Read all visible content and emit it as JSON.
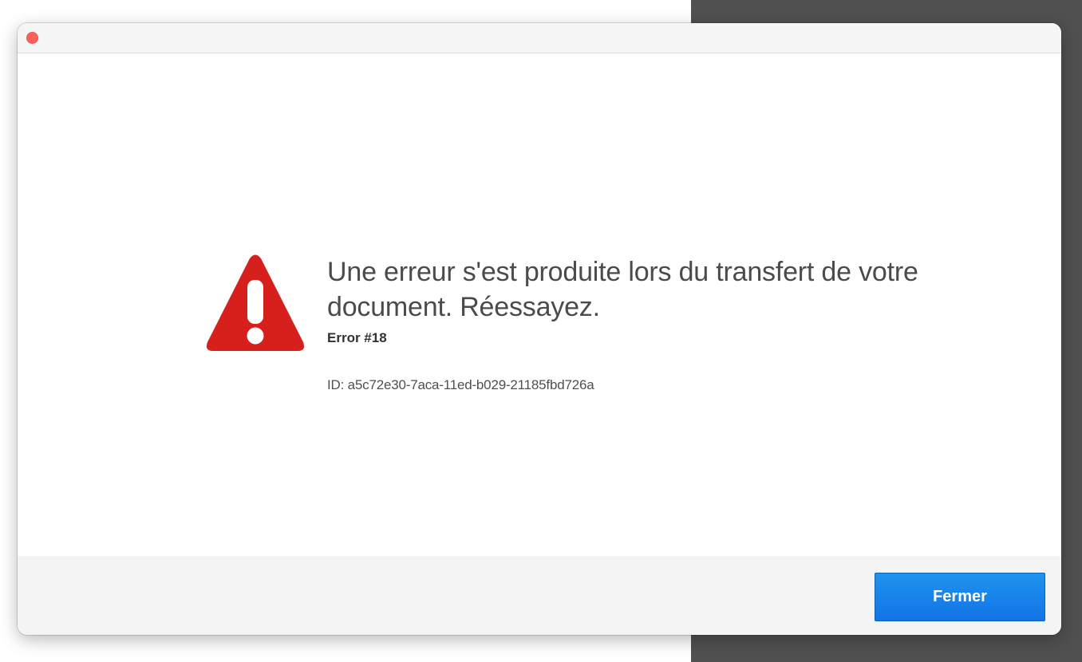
{
  "colors": {
    "accent_button": "#1473e6",
    "warning_red": "#d7201b",
    "window_close": "#fe5f57",
    "backdrop_dark": "#505050"
  },
  "window": {
    "close_control_icon": "traffic-light-close-icon"
  },
  "error": {
    "icon": "warning-triangle-icon",
    "message": "Une erreur s'est produite lors du transfert de votre document. Réessayez.",
    "code": "Error #18",
    "id_text": "ID: a5c72e30-7aca-11ed-b029-21185fbd726a"
  },
  "footer": {
    "close_label": "Fermer"
  }
}
